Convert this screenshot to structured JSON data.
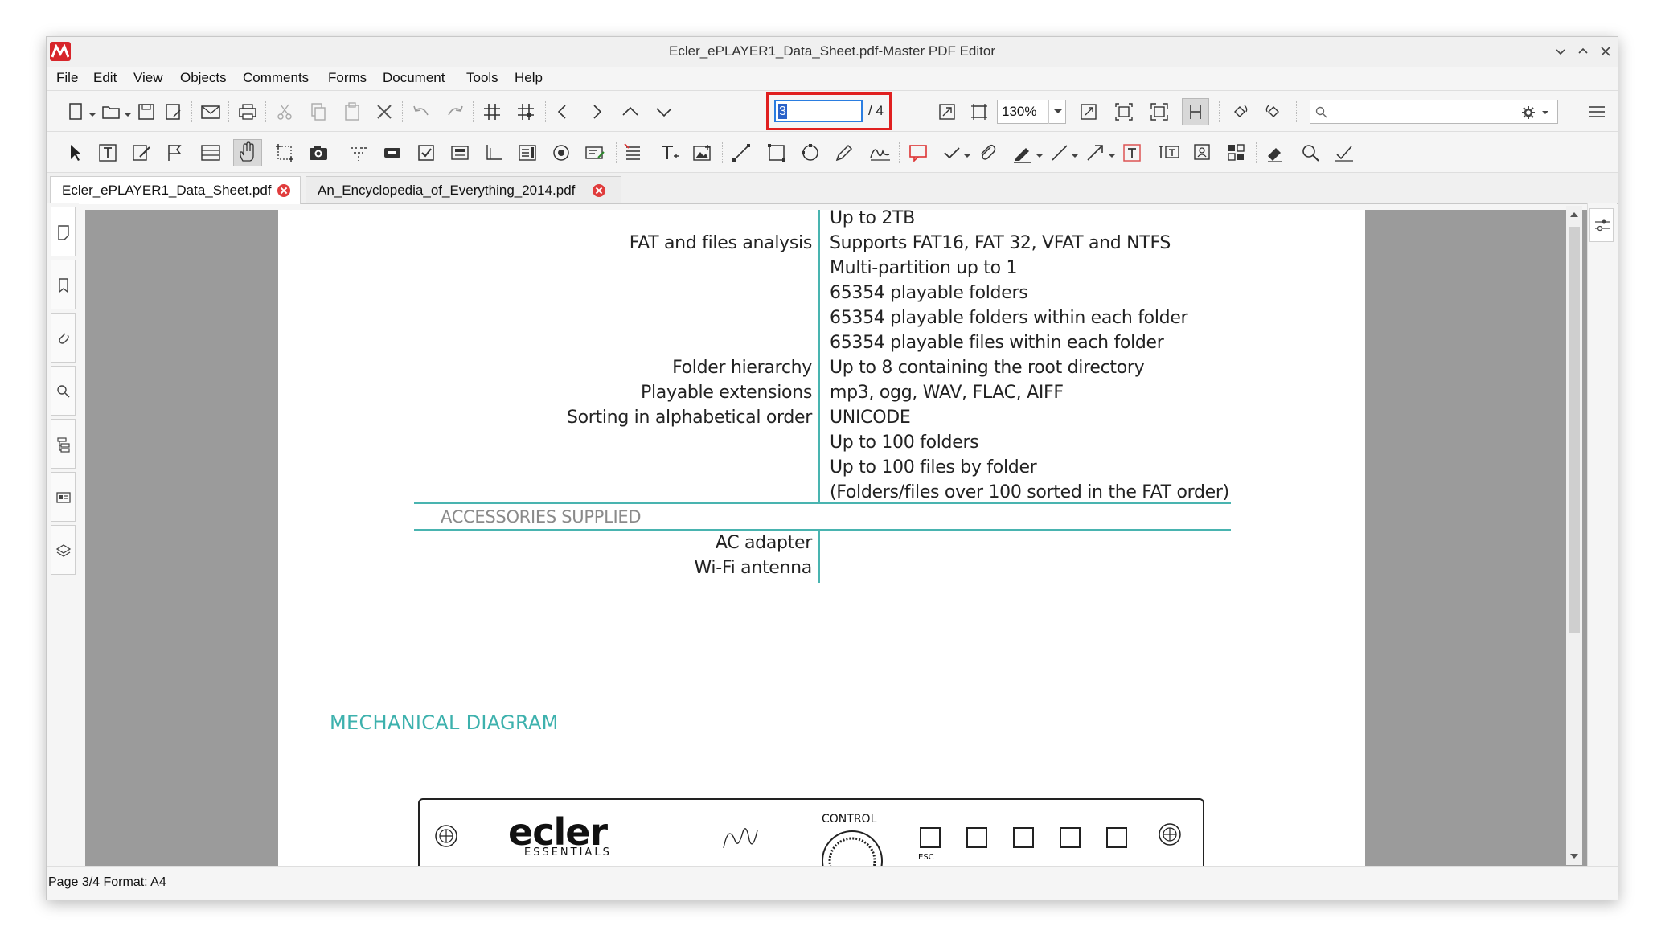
{
  "window": {
    "title": "Ecler_ePLAYER1_Data_Sheet.pdf-Master PDF Editor"
  },
  "menu": [
    "File",
    "Edit",
    "View",
    "Objects",
    "Comments",
    "Forms",
    "Document",
    "Tools",
    "Help"
  ],
  "toolbar": {
    "page_input_value": "3",
    "page_total": "/ 4",
    "zoom": "130%",
    "search_placeholder": ""
  },
  "tabs": [
    {
      "label": "Ecler_ePLAYER1_Data_Sheet.pdf",
      "active": true
    },
    {
      "label": "An_Encyclopedia_of_Everything_2014.pdf",
      "active": false
    }
  ],
  "document": {
    "spec_left": {
      "fat": "FAT and files analysis",
      "folder_hierarchy": "Folder hierarchy",
      "playable_ext": "Playable extensions",
      "sorting": "Sorting in alphabetical order"
    },
    "spec_right": [
      "Up to 2TB",
      "Supports FAT16, FAT 32, VFAT and NTFS",
      "Multi-partition up to 1",
      "65354 playable folders",
      "65354 playable folders within each folder",
      "65354 playable files within each folder",
      "Up to 8 containing the root directory",
      "mp3, ogg, WAV, FLAC, AIFF",
      "UNICODE",
      "Up to 100 folders",
      "Up to 100 files by folder",
      "(Folders/files over 100 sorted in the FAT order)"
    ],
    "accessories_heading": "ACCESSORIES SUPPLIED",
    "accessories": [
      "AC adapter",
      "Wi-Fi antenna"
    ],
    "mechanical_heading": "MECHANICAL DIAGRAM",
    "diagram": {
      "brand": "ecler",
      "brand_sub": "ESSENTIALS",
      "control_label": "CONTROL",
      "button_labels": [
        "ESC",
        "",
        "",
        "",
        ""
      ]
    }
  },
  "status": {
    "text": "Page 3/4 Format: A4"
  },
  "colors": {
    "accent_teal": "#49b4b0",
    "highlight_red": "#e02020",
    "selection_blue": "#2a62c9"
  }
}
